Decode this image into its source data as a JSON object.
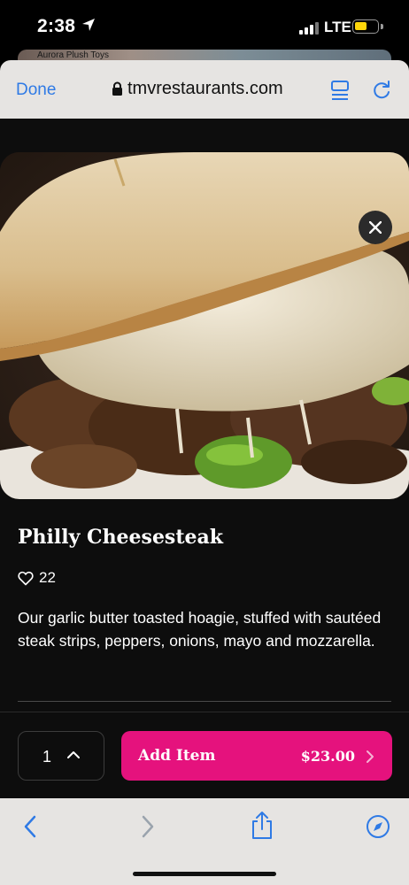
{
  "status_bar": {
    "time": "2:38",
    "network": "LTE",
    "battery_color": "#ffd60a"
  },
  "background_peek": {
    "text": "Aurora Plush Toys"
  },
  "browser": {
    "done_label": "Done",
    "url": "tmvrestaurants.com"
  },
  "item": {
    "title": "Philly Cheesesteak",
    "likes": "22",
    "description": "Our garlic butter toasted hoagie, stuffed with sautéed steak strips, peppers, onions, mayo and mozzarella."
  },
  "order": {
    "quantity": "1",
    "add_label": "Add Item",
    "price": "$23.00",
    "accent_color": "#e5127d"
  },
  "icons": [
    "location-arrow-icon",
    "lock-icon",
    "reader-icon",
    "reload-icon",
    "close-icon",
    "heart-icon",
    "chevron-up-icon",
    "chevron-right-icon",
    "back-icon",
    "forward-icon",
    "share-icon",
    "compass-icon"
  ]
}
